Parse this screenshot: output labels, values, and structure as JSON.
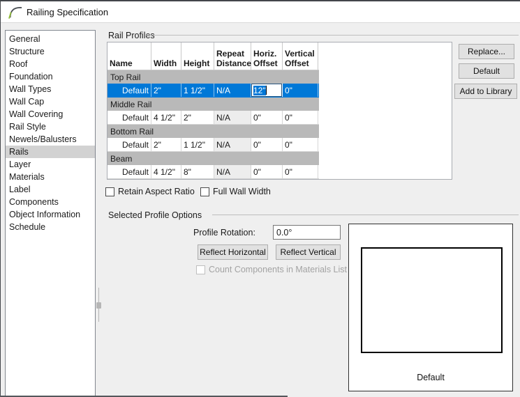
{
  "window": {
    "title": "Railing Specification"
  },
  "sidebar": {
    "items": [
      {
        "label": "General"
      },
      {
        "label": "Structure"
      },
      {
        "label": "Roof"
      },
      {
        "label": "Foundation"
      },
      {
        "label": "Wall Types"
      },
      {
        "label": "Wall Cap"
      },
      {
        "label": "Wall Covering"
      },
      {
        "label": "Rail Style"
      },
      {
        "label": "Newels/Balusters"
      },
      {
        "label": "Rails"
      },
      {
        "label": "Layer"
      },
      {
        "label": "Materials"
      },
      {
        "label": "Label"
      },
      {
        "label": "Components"
      },
      {
        "label": "Object Information"
      },
      {
        "label": "Schedule"
      }
    ],
    "selected": "Rails"
  },
  "rail_profiles": {
    "group_label": "Rail Profiles",
    "table": {
      "columns": [
        "Name",
        "Width",
        "Height",
        "Repeat Distance",
        "Horiz. Offset",
        "Vertical Offset"
      ],
      "groups": [
        {
          "group": "Top Rail",
          "rows": [
            {
              "name": "Default",
              "width": "2\"",
              "height": "1 1/2\"",
              "repeat": "N/A",
              "horiz": "12\"",
              "vert": "0\"",
              "selected": true,
              "editing_cell": "horiz"
            }
          ]
        },
        {
          "group": "Middle Rail",
          "rows": [
            {
              "name": "Default",
              "width": "4 1/2\"",
              "height": "2\"",
              "repeat": "N/A",
              "horiz": "0\"",
              "vert": "0\""
            }
          ]
        },
        {
          "group": "Bottom Rail",
          "rows": [
            {
              "name": "Default",
              "width": "2\"",
              "height": "1 1/2\"",
              "repeat": "N/A",
              "horiz": "0\"",
              "vert": "0\""
            }
          ]
        },
        {
          "group": "Beam",
          "rows": [
            {
              "name": "Default",
              "width": "4 1/2\"",
              "height": "8\"",
              "repeat": "N/A",
              "horiz": "0\"",
              "vert": "0\""
            }
          ]
        }
      ]
    },
    "buttons": {
      "replace": "Replace...",
      "default": "Default",
      "add_to_library": "Add to Library"
    },
    "checkboxes": [
      {
        "label": "Retain Aspect Ratio",
        "checked": false
      },
      {
        "label": "Full Wall Width",
        "checked": false
      }
    ]
  },
  "selected_profile_options": {
    "group_label": "Selected Profile Options",
    "rotation_label": "Profile Rotation:",
    "rotation_value": "0.0°",
    "reflect_horizontal": "Reflect Horizontal",
    "reflect_vertical": "Reflect Vertical",
    "count_components": {
      "label": "Count Components in Materials List",
      "checked": false,
      "disabled": true
    },
    "preview_caption": "Default"
  },
  "colors": {
    "selection_blue": "#0078d7",
    "group_row_gray": "#b9b9b9",
    "panel_bg": "#efefef",
    "sidebar_selected": "#d2d2d2",
    "button_bg": "#e1e1e1"
  }
}
